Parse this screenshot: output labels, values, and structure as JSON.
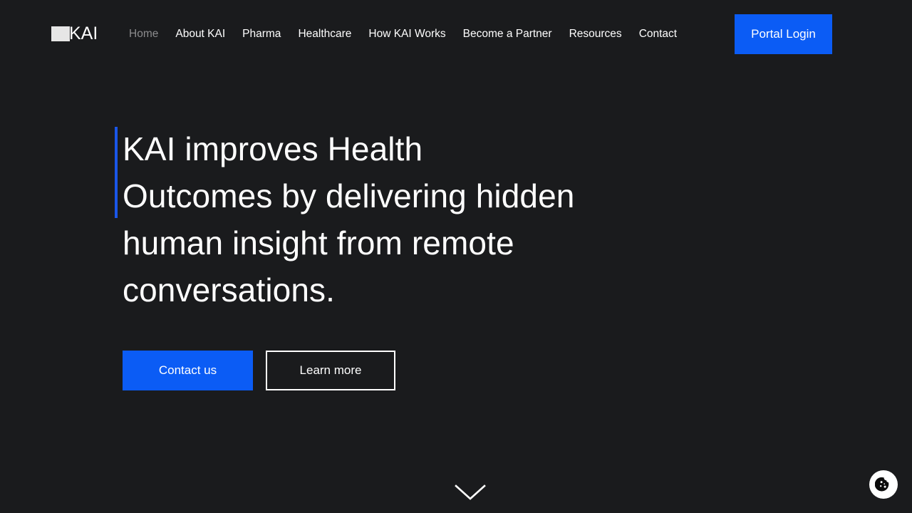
{
  "theme": {
    "background": "#1a1b1d",
    "accent_blue": "#0b5cf5",
    "accent_bar_blue": "#1a56e8",
    "text_primary": "#ffffff",
    "text_muted": "#8c8c8e"
  },
  "header": {
    "logo": {
      "mark": "square-logo-mark",
      "text": "KAI"
    },
    "nav_items": [
      {
        "label": "Home",
        "active": true
      },
      {
        "label": "About KAI",
        "active": false
      },
      {
        "label": "Pharma",
        "active": false
      },
      {
        "label": "Healthcare",
        "active": false
      },
      {
        "label": "How KAI Works",
        "active": false
      },
      {
        "label": "Become a Partner",
        "active": false
      },
      {
        "label": "Resources",
        "active": false
      },
      {
        "label": "Contact",
        "active": false
      }
    ],
    "portal_login_label": "Portal Login"
  },
  "hero": {
    "headline": "KAI improves Health Outcomes by delivering hidden human insight from remote conversations.",
    "primary_cta": "Contact us",
    "secondary_cta": "Learn more",
    "scroll_cue_icon": "chevron-down-icon"
  },
  "widgets": {
    "cookie_icon": "cookie-icon"
  }
}
